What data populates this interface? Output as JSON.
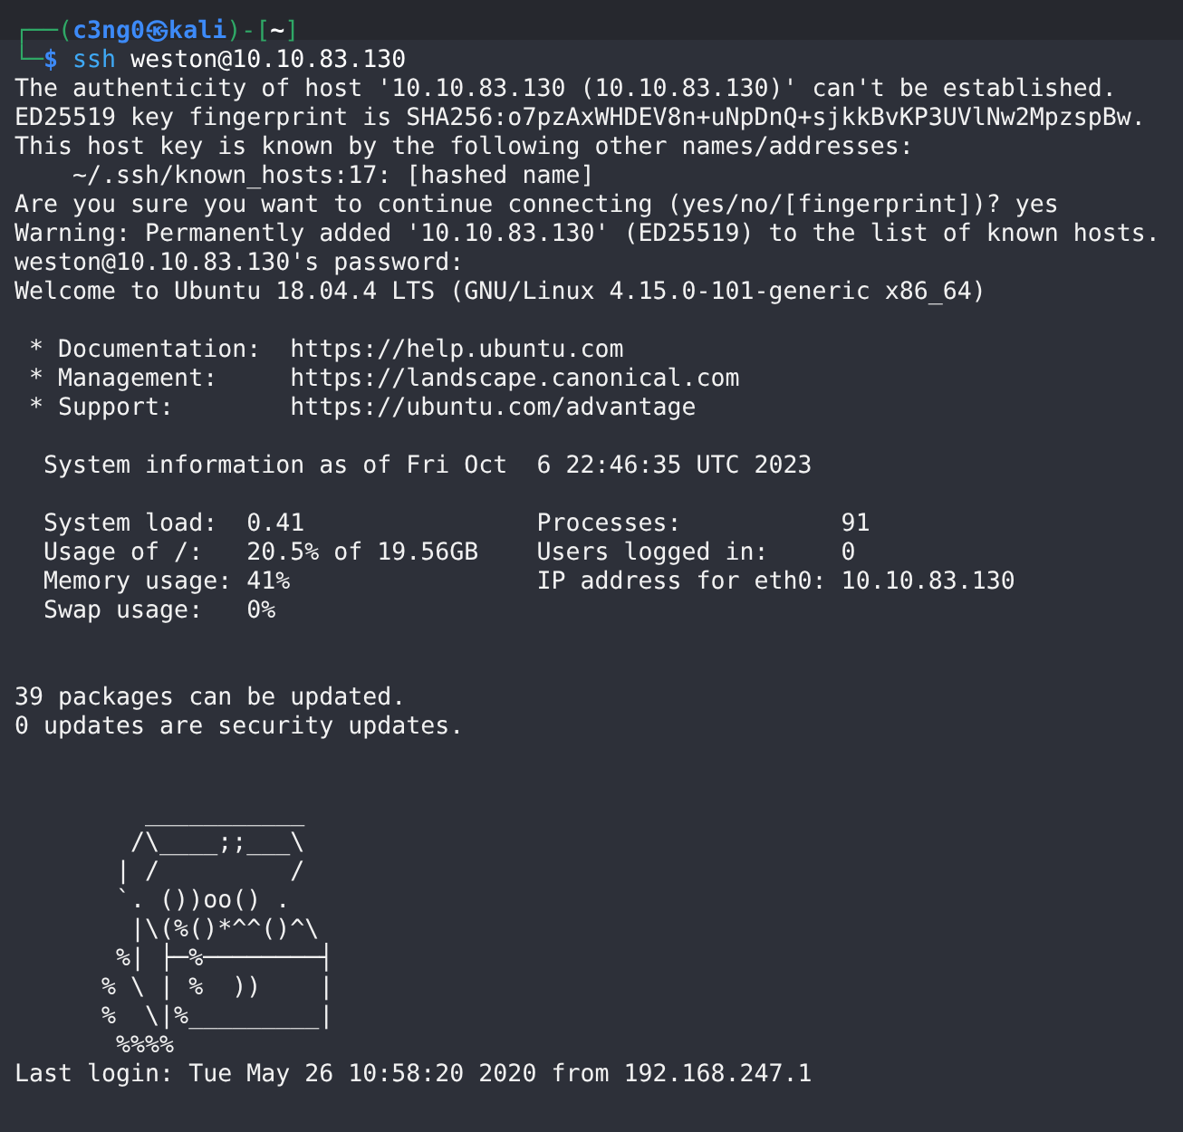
{
  "terminal": {
    "prompt": [
      [
        {
          "kind": "frame",
          "text": "┌──("
        },
        {
          "kind": "user",
          "text": "c3ng0㉿kali"
        },
        {
          "kind": "frame",
          "text": ")-["
        },
        {
          "kind": "cwd",
          "text": "~"
        },
        {
          "kind": "frame",
          "text": "]"
        }
      ],
      [
        {
          "kind": "frame",
          "text": "└─"
        },
        {
          "kind": "symbol",
          "text": "$"
        },
        {
          "kind": "command",
          "text": " ssh"
        },
        {
          "kind": "text",
          "text": " weston@10.10.83.130"
        }
      ]
    ],
    "output": [
      {
        "kind": "text",
        "text": "The authenticity of host '10.10.83.130 (10.10.83.130)' can't be established."
      },
      {
        "kind": "text",
        "text": "ED25519 key fingerprint is SHA256:o7pzAxWHDEV8n+uNpDnQ+sjkkBvKP3UVlNw2MpzspBw."
      },
      {
        "kind": "text",
        "text": "This host key is known by the following other names/addresses:"
      },
      {
        "kind": "text",
        "text": "    ~/.ssh/known_hosts:17: [hashed name]"
      },
      {
        "kind": "text",
        "text": "Are you sure you want to continue connecting (yes/no/[fingerprint])? yes"
      },
      {
        "kind": "text",
        "text": "Warning: Permanently added '10.10.83.130' (ED25519) to the list of known hosts."
      },
      {
        "kind": "text",
        "text": "weston@10.10.83.130's password:"
      },
      {
        "kind": "text",
        "text": "Welcome to Ubuntu 18.04.4 LTS (GNU/Linux 4.15.0-101-generic x86_64)"
      },
      {
        "kind": "blank"
      },
      {
        "kind": "text",
        "text": " * Documentation:  https://help.ubuntu.com"
      },
      {
        "kind": "text",
        "text": " * Management:     https://landscape.canonical.com"
      },
      {
        "kind": "text",
        "text": " * Support:        https://ubuntu.com/advantage"
      },
      {
        "kind": "blank"
      },
      {
        "kind": "text",
        "text": "  System information as of Fri Oct  6 22:46:35 UTC 2023"
      },
      {
        "kind": "blank"
      },
      {
        "kind": "text",
        "text": "  System load:  0.41                Processes:           91"
      },
      {
        "kind": "text",
        "text": "  Usage of /:   20.5% of 19.56GB    Users logged in:     0"
      },
      {
        "kind": "text",
        "text": "  Memory usage: 41%                 IP address for eth0: 10.10.83.130"
      },
      {
        "kind": "text",
        "text": "  Swap usage:   0%"
      },
      {
        "kind": "blank"
      },
      {
        "kind": "blank"
      },
      {
        "kind": "text",
        "text": "39 packages can be updated."
      },
      {
        "kind": "text",
        "text": "0 updates are security updates."
      },
      {
        "kind": "blank"
      },
      {
        "kind": "blank"
      },
      {
        "kind": "art",
        "lines": [
          "         ___________",
          "        /\\____;;___\\",
          "       | /         /",
          "       `. ())oo() .",
          "        |\\(%()*^^()^\\",
          "       %| ├─%────────┤",
          "      % \\ | %  ))    |",
          "      %  \\|%_________|",
          "       %%%%"
        ]
      },
      {
        "kind": "text",
        "text": "Last login: Tue May 26 10:58:20 2020 from 192.168.247.1"
      }
    ]
  }
}
